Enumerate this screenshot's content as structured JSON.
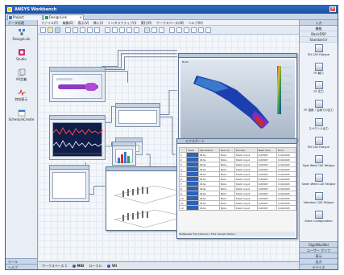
{
  "window": {
    "title": "ANSYS Workbench"
  },
  "tabs": [
    {
      "label": "Project"
    },
    {
      "label": "DesignLink"
    }
  ],
  "left_panel": {
    "header": "データ処理",
    "items": [
      {
        "label": "DesignLink"
      },
      {
        "label": "Studio"
      },
      {
        "label": "AS定義"
      },
      {
        "label": "時刻表示"
      },
      {
        "label": "ScheduleCreate"
      }
    ],
    "footer_1": "ツール",
    "footer_2": "ヘルプ"
  },
  "menu": [
    "ファイル(F)",
    "編集(E)",
    "表示(V)",
    "挿入(I)",
    "インタラクティブ(I)",
    "実行(R)",
    "ワークスペース(W)",
    "ヘルプ(H)"
  ],
  "window_3d": {
    "caption": "Node"
  },
  "table_window": {
    "title": "エクスポート",
    "columns": [
      "",
      "Node",
      "Nod Name",
      "Nom Id",
      "Domain",
      "Mesh Size",
      "Error"
    ],
    "rows": [
      [
        "1",
        "",
        "NULL",
        "NULL",
        "Static Input",
        "0.00567",
        "0.002918"
      ],
      [
        "2",
        "",
        "NULL",
        "NULL",
        "Static Input",
        "0.00567",
        "0.002918"
      ],
      [
        "3",
        "",
        "NULL",
        "NULL",
        "Static Input",
        "0.00567",
        "0.002918"
      ],
      [
        "4",
        "",
        "NULL",
        "NULL",
        "Static Input",
        "0.00567",
        "0.002918"
      ],
      [
        "5",
        "",
        "NULL",
        "NULL",
        "Static Input",
        "0.00567",
        "0.002918"
      ],
      [
        "6",
        "",
        "NULL",
        "NULL",
        "Static Input",
        "0.00567",
        "0.002918"
      ],
      [
        "7",
        "",
        "NULL",
        "NULL",
        "Static Input",
        "0.00567",
        "0.002918"
      ],
      [
        "8",
        "",
        "NULL",
        "NULL",
        "Static Input",
        "0.00567",
        "0.002918"
      ],
      [
        "9",
        "",
        "NULL",
        "NULL",
        "Static Input",
        "0.00567",
        "0.002918"
      ],
      [
        "10",
        "",
        "NULL",
        "NULL",
        "Static Input",
        "0.00567",
        "0.002918"
      ],
      [
        "11",
        "",
        "NULL",
        "NULL",
        "Static Input",
        "0.00567",
        "0.002918"
      ],
      [
        "12",
        "",
        "NULL",
        "NULL",
        "Static Input",
        "0.00567",
        "0.002918"
      ]
    ],
    "footer": "TextReader File   Channel 1   Title: Results   Table 1"
  },
  "right_panel": {
    "header": "入力",
    "sub_1": "機能",
    "sub_2": "BasicDSP",
    "sub_3": "Standard.Ir",
    "items": [
      {
        "label": "EN CAE Fatigue"
      },
      {
        "label": "FE 軸力"
      },
      {
        "label": "FE 応力"
      },
      {
        "label": "FE 指数 / 沿線での応力"
      },
      {
        "label": "スペクトル出力"
      },
      {
        "label": "EN CAE Fatigue"
      },
      {
        "label": "Spot Weld CAE Fatigue"
      },
      {
        "label": "Seam Weld CAE Fatigue"
      },
      {
        "label": "Vibration CAE Fatigue"
      },
      {
        "label": "Stack Configuration"
      }
    ],
    "footer_items": [
      "GlyphBuilder",
      "ユーザー グリフ",
      "表示",
      "出力",
      "デバイス"
    ]
  },
  "status": {
    "label_1": "ワークスペース 1",
    "label_2": "MID",
    "label_3": "ローカル",
    "label_4": "VII"
  },
  "colors": {
    "title_bar": "#1b4f9c",
    "accent": "#2f62b5",
    "canvas_bg": "#f3f6fa",
    "contour_high": "#d62828",
    "contour_low": "#1c3fb0"
  }
}
